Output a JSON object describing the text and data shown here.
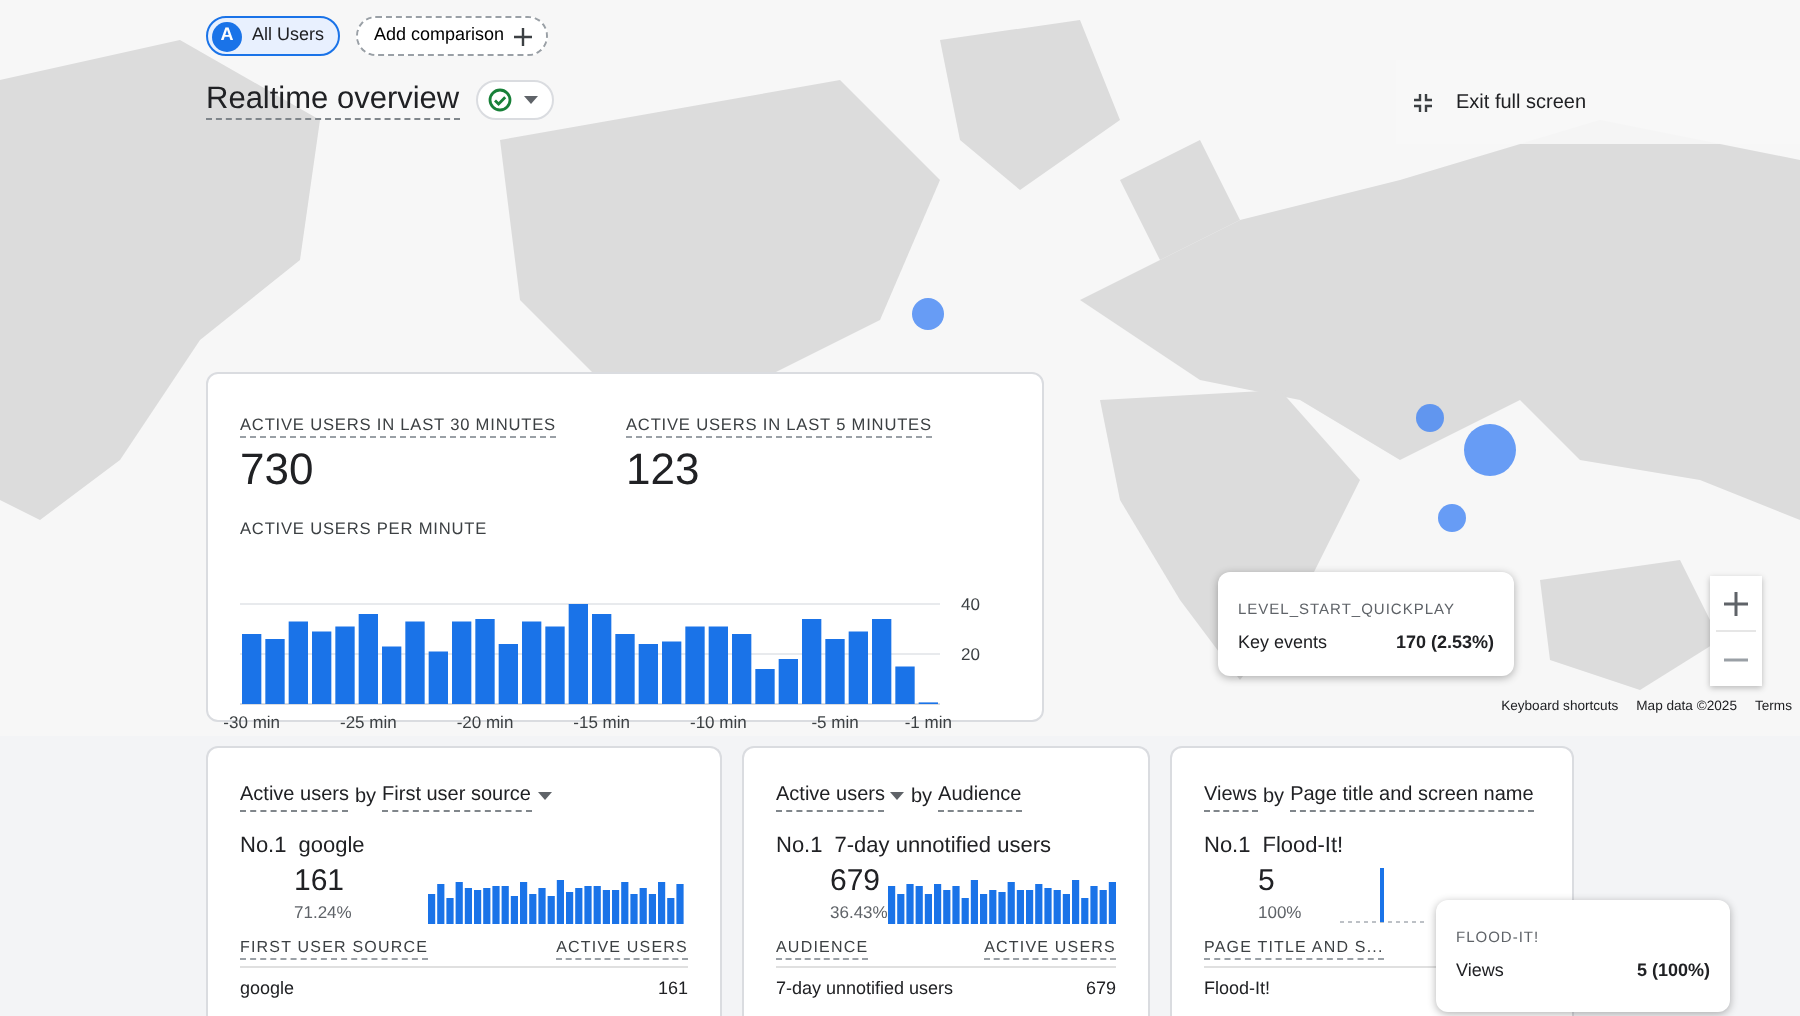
{
  "filters": [
    {
      "kind": "segment",
      "avatar": "A",
      "label": "All Users"
    },
    {
      "kind": "add",
      "label": "Add comparison"
    }
  ],
  "title": "Realtime overview",
  "exit_button": "Exit full screen",
  "summary": {
    "metrics": [
      {
        "label": "ACTIVE USERS IN LAST 30 MINUTES",
        "value": "730"
      },
      {
        "label": "ACTIVE USERS IN LAST 5 MINUTES",
        "value": "123"
      }
    ],
    "chart_title": "ACTIVE USERS PER MINUTE",
    "chart_data": {
      "type": "bar",
      "x": [
        -30,
        -29,
        -28,
        -27,
        -26,
        -25,
        -24,
        -23,
        -22,
        -21,
        -20,
        -19,
        -18,
        -17,
        -16,
        -15,
        -14,
        -13,
        -12,
        -11,
        -10,
        -9,
        -8,
        -7,
        -6,
        -5,
        -4,
        -3,
        -2,
        -1
      ],
      "series": [
        {
          "color": "#1a73e8",
          "values": [
            28,
            26,
            33,
            29,
            31,
            36,
            23,
            33,
            21,
            33,
            34,
            24,
            33,
            31,
            40,
            36,
            28,
            24,
            25,
            31,
            31,
            28,
            14,
            18,
            34,
            26,
            29,
            34,
            15,
            0
          ]
        }
      ],
      "xticks": [
        {
          "value": -30,
          "label": "-30 min"
        },
        {
          "value": -25,
          "label": "-25 min"
        },
        {
          "value": -20,
          "label": "-20 min"
        },
        {
          "value": -15,
          "label": "-15 min"
        },
        {
          "value": -10,
          "label": "-10 min"
        },
        {
          "value": -5,
          "label": "-5 min"
        },
        {
          "value": -1,
          "label": "-1 min"
        }
      ],
      "xlim": [
        -30.5,
        -0.5
      ],
      "ylim": [
        0,
        40
      ],
      "yticks": [
        20,
        40
      ]
    }
  },
  "map": {
    "kind": "picture",
    "tooltip": {
      "title": "LEVEL_START_QUICKPLAY",
      "label": "Key events",
      "value": "170 (2.53%)"
    },
    "attribution": [
      "Keyboard shortcuts",
      "Map data ©2025",
      "Terms"
    ]
  },
  "cards": [
    {
      "metric": "Active users",
      "by": "by",
      "dimension": "First user source",
      "metric_dropdown": false,
      "dimension_dropdown": true,
      "rank": "No.1",
      "top_name": "google",
      "top_value": "161",
      "top_share": "71.24%",
      "columns": [
        "FIRST USER SOURCE",
        "ACTIVE USERS"
      ],
      "rows": [
        [
          "google",
          "161"
        ]
      ]
    },
    {
      "metric": "Active users",
      "by": "by",
      "dimension": "Audience",
      "metric_dropdown": true,
      "dimension_dropdown": false,
      "rank": "No.1",
      "top_name": "7-day unnotified users",
      "top_value": "679",
      "top_share": "36.43%",
      "columns": [
        "AUDIENCE",
        "ACTIVE USERS"
      ],
      "rows": [
        [
          "7-day unnotified users",
          "679"
        ]
      ]
    },
    {
      "metric": "Views",
      "by": "by",
      "dimension": "Page title and screen name",
      "metric_dropdown": false,
      "dimension_dropdown": false,
      "rank": "No.1",
      "top_name": "Flood-It!",
      "top_value": "5",
      "top_share": "100%",
      "columns": [
        "PAGE TITLE AND S..."
      ],
      "rows": [
        [
          "Flood-It!"
        ]
      ],
      "tooltip": {
        "title": "FLOOD-IT!",
        "label": "Views",
        "value": "5 (100%)"
      }
    }
  ]
}
